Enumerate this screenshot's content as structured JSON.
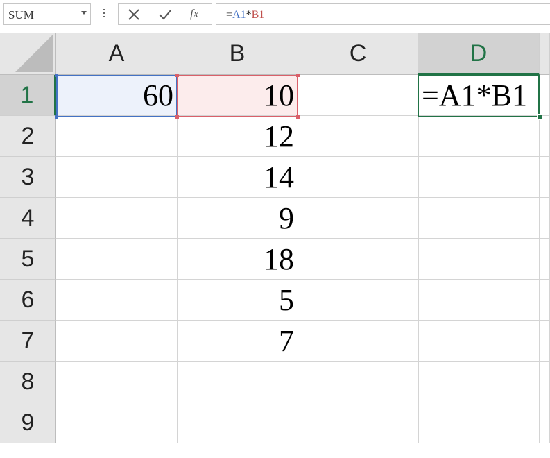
{
  "name_box": {
    "value": "SUM"
  },
  "formula_bar": {
    "cancel_icon": "x-cancel-icon",
    "enter_icon": "check-enter-icon",
    "fx_label": "fx",
    "formula_parts": [
      {
        "text": "=",
        "ref": ""
      },
      {
        "text": "A1",
        "ref": "a"
      },
      {
        "text": "*",
        "ref": ""
      },
      {
        "text": "B1",
        "ref": "b"
      }
    ]
  },
  "columns": [
    "A",
    "B",
    "C",
    "D"
  ],
  "active_column": "D",
  "rows": [
    "1",
    "2",
    "3",
    "4",
    "5",
    "6",
    "7",
    "8",
    "9"
  ],
  "active_row": "1",
  "cells": [
    [
      "60",
      "10",
      "",
      "=A1*B1"
    ],
    [
      "",
      "12",
      "",
      ""
    ],
    [
      "",
      "14",
      "",
      ""
    ],
    [
      "",
      "9",
      "",
      ""
    ],
    [
      "",
      "18",
      "",
      ""
    ],
    [
      "",
      "5",
      "",
      ""
    ],
    [
      "",
      "7",
      "",
      ""
    ],
    [
      "",
      "",
      "",
      ""
    ],
    [
      "",
      "",
      "",
      ""
    ]
  ],
  "editing_cell": "D1",
  "referenced_cells": [
    "A1",
    "B1"
  ],
  "colors": {
    "accent_green": "#217346",
    "ref_a_blue": "#4472c4",
    "ref_b_red": "#d9606a"
  }
}
